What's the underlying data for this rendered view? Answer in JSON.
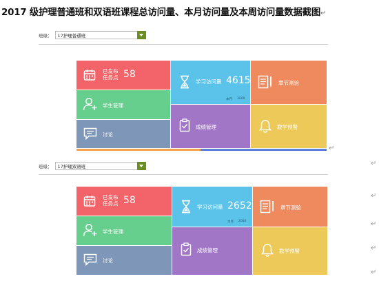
{
  "title": "2017 级护理普通班和双语班课程总访问量、本月访问量及本周访问量数据截图",
  "return_mark": "↵",
  "panels": [
    {
      "selector": {
        "label": "班级：",
        "value": "17护理普通班"
      },
      "tiles": {
        "published_line1": "已发布",
        "published_line2": "任务点",
        "published_count": "58",
        "student_mgmt": "学生管理",
        "discussion": "讨论",
        "visits_label": "学习访问量",
        "visits_count": "4615",
        "month_label": "本月",
        "month_count": "3609",
        "grade_mgmt": "成绩管理",
        "chapter_test": "章节测验",
        "teaching_alert": "教学预警"
      }
    },
    {
      "selector": {
        "label": "班级：",
        "value": "17护理双语班"
      },
      "tiles": {
        "published_line1": "已发布",
        "published_line2": "任务点",
        "published_count": "58",
        "student_mgmt": "学生管理",
        "discussion": "讨论",
        "visits_label": "学习访问量",
        "visits_count": "2652",
        "month_label": "本月",
        "month_count": "2080",
        "grade_mgmt": "成绩管理",
        "chapter_test": "章节测验",
        "teaching_alert": "教学预警"
      }
    }
  ],
  "colors": {
    "red": "#f2646a",
    "green": "#67cf8e",
    "slate": "#7e97b9",
    "cyan": "#5bc2ea",
    "purple": "#a176c6",
    "orange": "#ee8a5d",
    "yellow": "#edc95a",
    "select_button": "#6b8e23"
  },
  "icons": [
    "calendar-icon",
    "user-add-icon",
    "chat-icon",
    "hourglass-icon",
    "document-icon",
    "clipboard-check-icon",
    "bell-icon",
    "chevron-down-icon"
  ]
}
